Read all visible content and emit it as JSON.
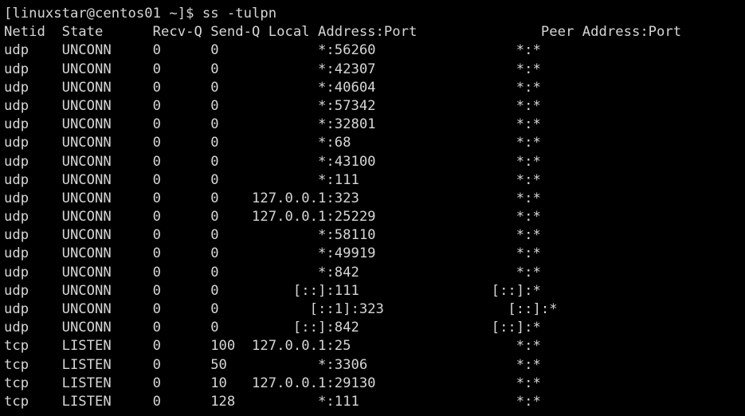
{
  "terminal": {
    "background_color": "#000000",
    "foreground_color": "#d6d6d6",
    "prompt": {
      "user": "linuxstar",
      "host": "centos01",
      "cwd": "~",
      "symbol": "$",
      "full_prompt": "[linuxstar@centos01 ~]$",
      "command": "ss -tulpn",
      "full_line": "[linuxstar@centos01 ~]$ ss -tulpn"
    },
    "columns": {
      "netid": "Netid",
      "state": "State",
      "recv_q": "Recv-Q",
      "send_q": "Send-Q",
      "local_address": "Local Address:Port",
      "peer_address": "Peer Address:Port"
    },
    "header_line": "Netid  State      Recv-Q Send-Q Local Address:Port               Peer Address:Port",
    "rows": [
      {
        "netid": "udp",
        "state": "UNCONN",
        "recv_q": "0",
        "send_q": "0",
        "local_address": "*:56260",
        "peer_address": "*:*",
        "line": "udp    UNCONN     0      0            *:56260                 *:*"
      },
      {
        "netid": "udp",
        "state": "UNCONN",
        "recv_q": "0",
        "send_q": "0",
        "local_address": "*:42307",
        "peer_address": "*:*",
        "line": "udp    UNCONN     0      0            *:42307                 *:*"
      },
      {
        "netid": "udp",
        "state": "UNCONN",
        "recv_q": "0",
        "send_q": "0",
        "local_address": "*:40604",
        "peer_address": "*:*",
        "line": "udp    UNCONN     0      0            *:40604                 *:*"
      },
      {
        "netid": "udp",
        "state": "UNCONN",
        "recv_q": "0",
        "send_q": "0",
        "local_address": "*:57342",
        "peer_address": "*:*",
        "line": "udp    UNCONN     0      0            *:57342                 *:*"
      },
      {
        "netid": "udp",
        "state": "UNCONN",
        "recv_q": "0",
        "send_q": "0",
        "local_address": "*:32801",
        "peer_address": "*:*",
        "line": "udp    UNCONN     0      0            *:32801                 *:*"
      },
      {
        "netid": "udp",
        "state": "UNCONN",
        "recv_q": "0",
        "send_q": "0",
        "local_address": "*:68",
        "peer_address": "*:*",
        "line": "udp    UNCONN     0      0            *:68                    *:*"
      },
      {
        "netid": "udp",
        "state": "UNCONN",
        "recv_q": "0",
        "send_q": "0",
        "local_address": "*:43100",
        "peer_address": "*:*",
        "line": "udp    UNCONN     0      0            *:43100                 *:*"
      },
      {
        "netid": "udp",
        "state": "UNCONN",
        "recv_q": "0",
        "send_q": "0",
        "local_address": "*:111",
        "peer_address": "*:*",
        "line": "udp    UNCONN     0      0            *:111                   *:*"
      },
      {
        "netid": "udp",
        "state": "UNCONN",
        "recv_q": "0",
        "send_q": "0",
        "local_address": "127.0.0.1:323",
        "peer_address": "*:*",
        "line": "udp    UNCONN     0      0    127.0.0.1:323                   *:*"
      },
      {
        "netid": "udp",
        "state": "UNCONN",
        "recv_q": "0",
        "send_q": "0",
        "local_address": "127.0.0.1:25229",
        "peer_address": "*:*",
        "line": "udp    UNCONN     0      0    127.0.0.1:25229                 *:*"
      },
      {
        "netid": "udp",
        "state": "UNCONN",
        "recv_q": "0",
        "send_q": "0",
        "local_address": "*:58110",
        "peer_address": "*:*",
        "line": "udp    UNCONN     0      0            *:58110                 *:*"
      },
      {
        "netid": "udp",
        "state": "UNCONN",
        "recv_q": "0",
        "send_q": "0",
        "local_address": "*:49919",
        "peer_address": "*:*",
        "line": "udp    UNCONN     0      0            *:49919                 *:*"
      },
      {
        "netid": "udp",
        "state": "UNCONN",
        "recv_q": "0",
        "send_q": "0",
        "local_address": "*:842",
        "peer_address": "*:*",
        "line": "udp    UNCONN     0      0            *:842                   *:*"
      },
      {
        "netid": "udp",
        "state": "UNCONN",
        "recv_q": "0",
        "send_q": "0",
        "local_address": "[::]:111",
        "peer_address": "[::]:*",
        "line": "udp    UNCONN     0      0         [::]:111                [::]:*"
      },
      {
        "netid": "udp",
        "state": "UNCONN",
        "recv_q": "0",
        "send_q": "0",
        "local_address": "[::1]:323",
        "peer_address": "[::]:*",
        "line": "udp    UNCONN     0      0           [::1]:323               [::]:*"
      },
      {
        "netid": "udp",
        "state": "UNCONN",
        "recv_q": "0",
        "send_q": "0",
        "local_address": "[::]:842",
        "peer_address": "[::]:*",
        "line": "udp    UNCONN     0      0         [::]:842                [::]:*"
      },
      {
        "netid": "tcp",
        "state": "LISTEN",
        "recv_q": "0",
        "send_q": "100",
        "local_address": "127.0.0.1:25",
        "peer_address": "*:*",
        "line": "tcp    LISTEN     0      100  127.0.0.1:25                    *:*"
      },
      {
        "netid": "tcp",
        "state": "LISTEN",
        "recv_q": "0",
        "send_q": "50",
        "local_address": "*:3306",
        "peer_address": "*:*",
        "line": "tcp    LISTEN     0      50           *:3306                  *:*"
      },
      {
        "netid": "tcp",
        "state": "LISTEN",
        "recv_q": "0",
        "send_q": "10",
        "local_address": "127.0.0.1:29130",
        "peer_address": "*:*",
        "line": "tcp    LISTEN     0      10   127.0.0.1:29130                 *:*"
      },
      {
        "netid": "tcp",
        "state": "LISTEN",
        "recv_q": "0",
        "send_q": "128",
        "local_address": "*:111",
        "peer_address": "*:*",
        "line": "tcp    LISTEN     0      128          *:111                   *:*"
      }
    ]
  }
}
